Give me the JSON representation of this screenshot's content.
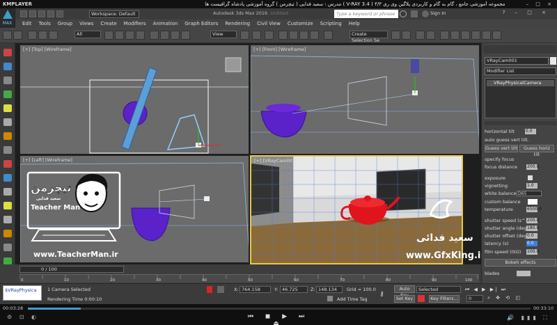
{
  "player": {
    "logo": "KMPLAYER",
    "title": "مجموعه آموزشی جامع ، گام به گام و کاربردی پلاگین وی ری ۳/۳  ( V-RAY 3.4 )  مدرس : سعید فدایی ( تیچرمن ) گروه آموزشی پادشاه گرافیست ها",
    "window_controls": "– □ ×",
    "time_current": "00:03:28",
    "time_total": "00:33:10"
  },
  "app": {
    "logo_text": "MAX",
    "workspace": "Workspace: Default",
    "title": "Autodesk 3ds Max 2016",
    "title_dim": "Untitled",
    "search_placeholder": "Type a keyword or phrase",
    "signin": "Sign In",
    "menu": [
      "Edit",
      "Tools",
      "Group",
      "Views",
      "Create",
      "Modifiers",
      "Animation",
      "Graph Editors",
      "Rendering",
      "Civil View",
      "Customize",
      "Scripting",
      "Help"
    ],
    "selection_filter": "All",
    "ref_coord": "View",
    "named_selection": "Create Selection Se"
  },
  "viewports": {
    "top": "[+] [Top] [Wireframe]",
    "front": "[+] [Front] [Wireframe]",
    "left": "[+] [Left] [Wireframe]",
    "camera": "[+] [VRayCam001]"
  },
  "overlay": {
    "brand_fa": "تیچرمن",
    "brand_sub": "سعید فدایی",
    "brand_en": "Teacher Man",
    "url_left": "www.TeacherMan.ir",
    "name_fa": "سعید فدائی",
    "url_right": "www.GfxKing.ir"
  },
  "command_panel": {
    "object_name": "VRayCam001",
    "modifier_list": "Modifier List",
    "stack_item": "VRayPhysicalCamera",
    "params": [
      {
        "label": "horizontal tilt",
        "value": "0.0"
      },
      {
        "label": "auto guess vert tilt.",
        "value": ""
      },
      {
        "label": "specify focus",
        "value": ""
      },
      {
        "label": "focus distance",
        "value": "200.0"
      },
      {
        "label": "exposure",
        "value": ""
      },
      {
        "label": "vignetting",
        "value": "1.0"
      },
      {
        "label": "white balance",
        "value": "D65"
      },
      {
        "label": "custom balance",
        "value": ""
      },
      {
        "label": "temperature",
        "value": "6500.0"
      },
      {
        "label": "shutter speed (s^-1)",
        "value": "200.0"
      },
      {
        "label": "shutter angle (deg)",
        "value": "180.0"
      },
      {
        "label": "shutter offset (deg)",
        "value": "0.0"
      },
      {
        "label": "latency (s)",
        "value": "0.0"
      },
      {
        "label": "film speed (ISO)",
        "value": "100.0"
      }
    ],
    "guess_vert": "Guess vert tilt",
    "guess_horiz": "Guess horiz tilt",
    "bokeh_header": "Bokeh effects",
    "blades": "blades"
  },
  "timeline": {
    "frame": "0 / 100",
    "ticks": [
      "0",
      "5",
      "10",
      "15",
      "20",
      "25",
      "30",
      "35",
      "40",
      "45",
      "50",
      "55",
      "60",
      "65",
      "70",
      "75",
      "80",
      "85",
      "90",
      "95",
      "100"
    ]
  },
  "status": {
    "script_field": "$VRayPhysica",
    "selected": "1 Camera Selected",
    "rendering_time": "Rendering Time  0:00:10",
    "x_label": "X:",
    "x": "764.158",
    "y_label": "Y:",
    "y": "46.725",
    "z_label": "Z:",
    "z": "148.134",
    "grid": "Grid = 100.0",
    "add_time_tag": "Add Time Tag",
    "auto_key": "Auto Key",
    "selected_dd": "Selected",
    "set_key": "Set Key",
    "key_filters": "Key Filters...",
    "frame_field": "0"
  },
  "colors": {
    "accent": "#3aa0c8",
    "camera_border": "#e8c94a",
    "teapot": "#e0141c",
    "wire_blue": "#3b6bd9",
    "teapot_wire": "#6a22c8"
  }
}
